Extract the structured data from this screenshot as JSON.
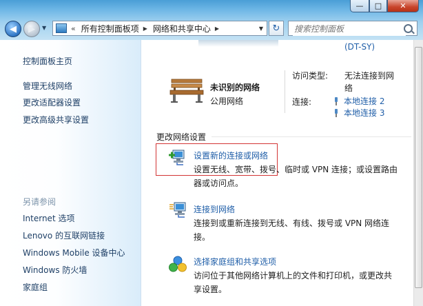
{
  "window": {
    "controls": {
      "minimize": "—",
      "maximize": "□",
      "close": "✕"
    }
  },
  "address": {
    "chevron": "«",
    "crumbs": [
      "所有控制面板项",
      "网络和共享中心"
    ],
    "refresh_icon": "↻"
  },
  "search": {
    "placeholder": "搜索控制面板"
  },
  "left_pane": {
    "home": "控制面板主页",
    "tasks": [
      "管理无线网络",
      "更改适配器设置",
      "更改高级共享设置"
    ],
    "see_also_heading": "另请参阅",
    "see_also": [
      "Internet 选项",
      "Lenovo 的互联网链接",
      "Windows Mobile 设备中心",
      "Windows 防火墙",
      "家庭组"
    ]
  },
  "network": {
    "truncated_text": "(DT-SY)",
    "name": "未识别的网络",
    "type": "公用网络",
    "access_label": "访问类型:",
    "access_value_line1": "无法连接到网",
    "access_value_line2": "络",
    "connections_label": "连接:",
    "connections": [
      "本地连接 2",
      "本地连接 3"
    ]
  },
  "change_settings": {
    "title": "更改网络设置",
    "tasks": [
      {
        "link": "设置新的连接或网络",
        "desc_line1": "设置无线、宽带、拨号、临时或 VPN 连接；或设置路由",
        "desc_line2": "器或访问点。"
      },
      {
        "link": "连接到网络",
        "desc_line1": "连接到或重新连接到无线、有线、拨号或 VPN 网络连",
        "desc_line2": "接。"
      },
      {
        "link": "选择家庭组和共享选项",
        "desc_line1": "访问位于其他网络计算机上的文件和打印机，或更改共",
        "desc_line2": "享设置。"
      }
    ]
  },
  "colors": {
    "link": "#1f5ea8",
    "highlight_border": "#d23434",
    "left_pane_link": "#1e3f66"
  }
}
